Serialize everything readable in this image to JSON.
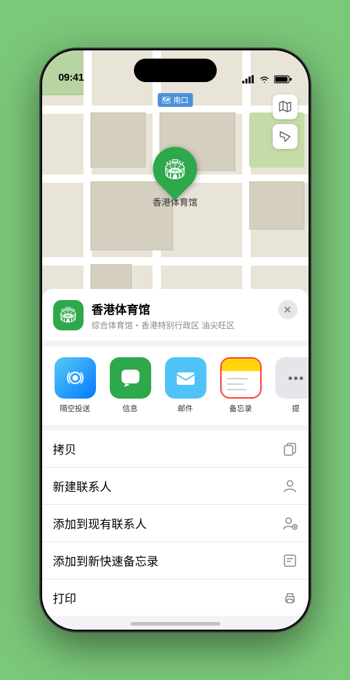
{
  "statusBar": {
    "time": "09:41",
    "timeArrow": "▶"
  },
  "map": {
    "label": "南口",
    "pinLabel": "香港体育馆"
  },
  "locationCard": {
    "name": "香港体育馆",
    "subtitle": "综合体育馆・香港特别行政区 油尖旺区",
    "closeBtnLabel": "×"
  },
  "shareItems": [
    {
      "id": "airdrop",
      "label": "隔空投送",
      "icon": "📶"
    },
    {
      "id": "message",
      "label": "信息",
      "icon": "💬"
    },
    {
      "id": "mail",
      "label": "邮件",
      "icon": "✉️"
    },
    {
      "id": "notes",
      "label": "备忘录",
      "icon": "📝"
    },
    {
      "id": "more",
      "label": "提",
      "icon": "···"
    }
  ],
  "actions": [
    {
      "id": "copy",
      "label": "拷贝",
      "icon": "⎘"
    },
    {
      "id": "new-contact",
      "label": "新建联系人",
      "icon": "👤"
    },
    {
      "id": "add-contact",
      "label": "添加到现有联系人",
      "icon": "👤+"
    },
    {
      "id": "quick-note",
      "label": "添加到新快速备忘录",
      "icon": "📋"
    },
    {
      "id": "print",
      "label": "打印",
      "icon": "🖨"
    }
  ]
}
